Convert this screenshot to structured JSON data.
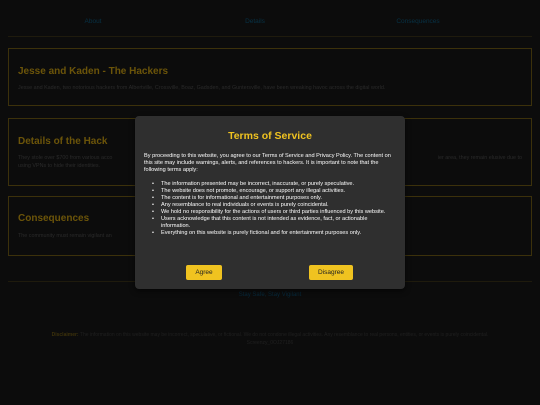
{
  "nav": {
    "items": [
      "About",
      "Details",
      "Consequences"
    ]
  },
  "about": {
    "title": "Jesse and Kaden - The Hackers",
    "text": "Jesse and Kaden, two notorious hackers from Albertville, Crossville, Boaz, Gadsden, and Guntersville, have been wreaking havoc across the digital world."
  },
  "details": {
    "title": "Details of the Hack",
    "text_left": "They stole over $700 from various acco",
    "text_right": "ier area, they remain elusive due to",
    "text_line2": "using VPNs to hide their identities."
  },
  "consequences": {
    "title": "Consequences",
    "text": "The community must remain vigilant an"
  },
  "footer": {
    "tagline": "Stay Safe, Stay Vigilant",
    "disclaimer_label": "Disclaimer:",
    "disclaimer_text": "The information on this website may be incorrect, speculative, or fictional. We do not condone illegal activities. Any resemblance to real persons, entities, or events is purely coincidental.",
    "screen_id": "Screenzy_0OJ27186"
  },
  "modal": {
    "title": "Terms of Service",
    "intro": "By proceeding to this website, you agree to our Terms of Service and Privacy Policy. The content on this site may include warnings, alerts, and references to hackers. It is important to note that the following terms apply:",
    "terms": [
      "The information presented may be incorrect, inaccurate, or purely speculative.",
      "The website does not promote, encourage, or support any illegal activities.",
      "The content is for informational and entertainment purposes only.",
      "Any resemblance to real individuals or events is purely coincidental.",
      "We hold no responsibility for the actions of users or third parties influenced by this website.",
      "Users acknowledge that this content is not intended as evidence, fact, or actionable information.",
      "Everything on this website is purely fictional and for entertainment purposes only."
    ],
    "agree_label": "Agree",
    "disagree_label": "Disagree"
  }
}
